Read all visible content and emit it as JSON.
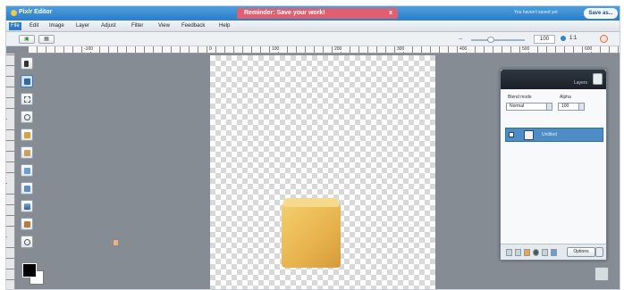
{
  "titlebar": {
    "app_name": "Pixlr Editor",
    "reminder": "Reminder: Save your work!",
    "reminder_close": "x",
    "signed_in": "You haven't saved yet",
    "save_button": "Save as..."
  },
  "menu": {
    "items": [
      "File",
      "Edit",
      "Image",
      "Layer",
      "Adjust",
      "Filter",
      "View",
      "Feedback",
      "Help"
    ],
    "active": "File"
  },
  "toolbar": {
    "zoom_value": "100",
    "zoom_fit": "1:1"
  },
  "ruler": {
    "ticks": [
      "-100",
      "0",
      "100",
      "200",
      "300",
      "400",
      "500",
      "600"
    ]
  },
  "layers_panel": {
    "title": "Layers",
    "blend_label": "Blend mode",
    "blend_value": "Normal",
    "alpha_label": "Alpha",
    "alpha_value": "100",
    "layer_name": "Untitled",
    "options_label": "Options"
  },
  "colors": {
    "accent": "#2f7ac2",
    "reminder": "#e06070",
    "workspace": "#858c94",
    "selected_layer": "#4d8cc4"
  },
  "icons": [
    "select-icon",
    "crop-icon",
    "marquee-icon",
    "lasso-icon",
    "pencil-icon",
    "brush-icon",
    "eraser-icon",
    "fill-icon",
    "gradient-icon",
    "stamp-icon",
    "zoom-icon"
  ]
}
